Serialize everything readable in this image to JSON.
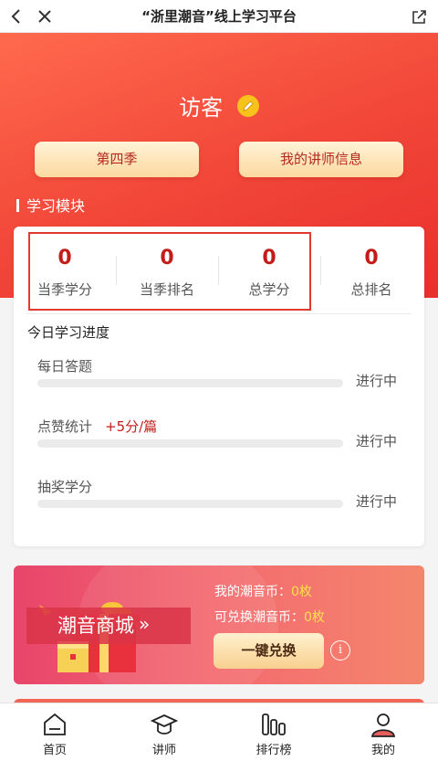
{
  "topbar": {
    "title": "“浙里潮音”线上学习平台"
  },
  "profile": {
    "name": "访客"
  },
  "buttons": {
    "season": "第四季",
    "teacher_info": "我的讲师信息"
  },
  "section": {
    "title": "学习模块"
  },
  "stats": [
    {
      "value": "0",
      "label": "当季学分"
    },
    {
      "value": "0",
      "label": "当季排名"
    },
    {
      "value": "0",
      "label": "总学分"
    },
    {
      "value": "0",
      "label": "总排名"
    }
  ],
  "progress": {
    "title": "今日学习进度",
    "items": [
      {
        "name": "每日答题",
        "extra": "",
        "status": "进行中",
        "fraction": 0
      },
      {
        "name": "点赞统计",
        "extra": "+5分/篇",
        "status": "进行中",
        "fraction": 0
      },
      {
        "name": "抽奖学分",
        "extra": "",
        "status": "进行中",
        "fraction": 0
      }
    ]
  },
  "mall": {
    "title": "潮音商城",
    "arrow": "»",
    "my_coins_label": "我的潮音币：",
    "my_coins_value": "0枚",
    "redeemable_label": "可兑换潮音币：",
    "redeemable_value": "0枚",
    "redeem_button": "一键兑换",
    "info": "i"
  },
  "tabs": [
    {
      "label": "首页",
      "icon": "home-icon"
    },
    {
      "label": "讲师",
      "icon": "graduation-cap-icon"
    },
    {
      "label": "排行榜",
      "icon": "ranking-bars-icon"
    },
    {
      "label": "我的",
      "icon": "user-icon"
    }
  ],
  "colors": {
    "accent": "#e23a2f",
    "stat_number": "#c21d1a",
    "coin_value": "#ffe14d",
    "pill_text": "#b5291f"
  }
}
